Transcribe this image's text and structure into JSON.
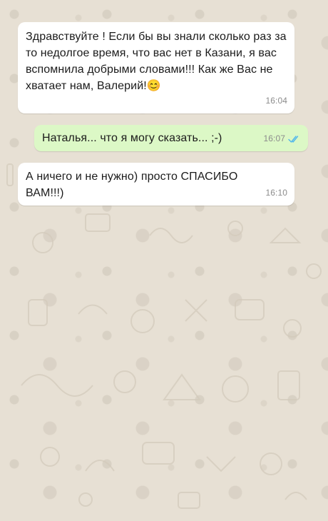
{
  "chat": {
    "messages": [
      {
        "direction": "incoming",
        "text": "Здравствуйте ! Если бы вы знали сколько раз за то недолгое время, что вас нет в Казани, я вас вспомнила добрыми словами!!! Как же Вас не хватает нам, Валерий!😊",
        "time": "16:04"
      },
      {
        "direction": "outgoing",
        "text": "Наталья... что я могу сказать... ;-)",
        "time": "16:07",
        "status_icon": "double-check-read-icon"
      },
      {
        "direction": "incoming",
        "text": "А ничего и не нужно) просто СПАСИБО ВАМ!!!)",
        "time": "16:10"
      }
    ]
  },
  "colors": {
    "wallpaper": "#e7e0d4",
    "incoming_bubble": "#ffffff",
    "outgoing_bubble": "#dcf8c6",
    "read_tick": "#4fb6ec",
    "timestamp": "#8c8c8c"
  }
}
